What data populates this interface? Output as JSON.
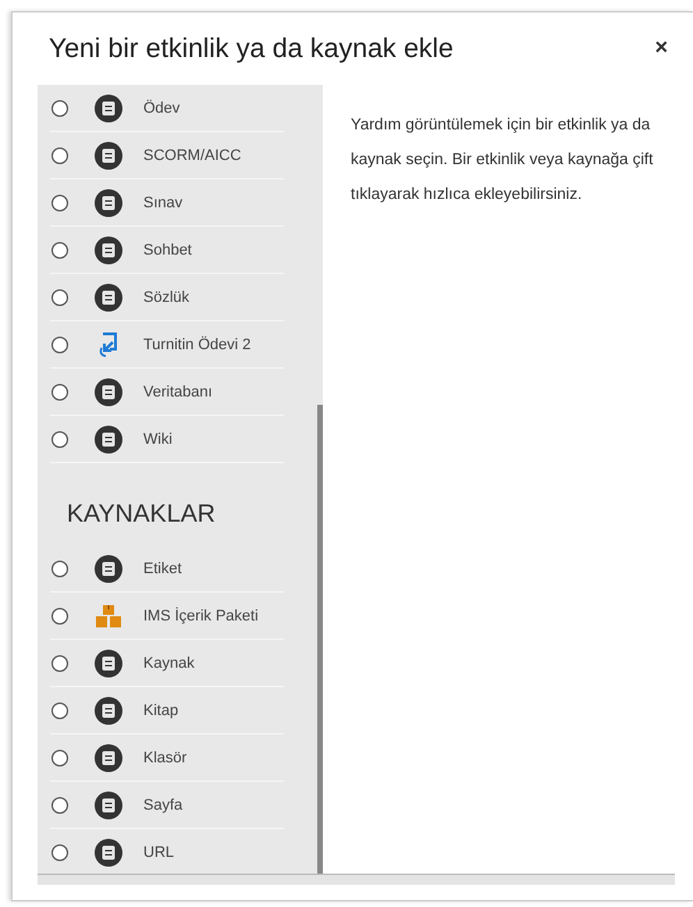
{
  "dialog": {
    "title": "Yeni bir etkinlik ya da kaynak ekle",
    "close": "×"
  },
  "sections": [
    {
      "items": [
        {
          "label": "Ödev",
          "kind": "module",
          "selected": false
        },
        {
          "label": "SCORM/AICC",
          "kind": "module",
          "selected": false
        },
        {
          "label": "Sınav",
          "kind": "module",
          "selected": false
        },
        {
          "label": "Sohbet",
          "kind": "module",
          "selected": false
        },
        {
          "label": "Sözlük",
          "kind": "module",
          "selected": false
        },
        {
          "label": "Turnitin Ödevi 2",
          "kind": "plugin",
          "selected": false
        },
        {
          "label": "Veritabanı",
          "kind": "module",
          "selected": false
        },
        {
          "label": "Wiki",
          "kind": "module",
          "selected": false
        }
      ]
    },
    {
      "heading": "KAYNAKLAR",
      "items": [
        {
          "label": "Etiket",
          "kind": "module",
          "selected": false
        },
        {
          "label": "IMS İçerik Paketi",
          "kind": "package",
          "selected": false
        },
        {
          "label": "Kaynak",
          "kind": "module",
          "selected": false
        },
        {
          "label": "Kitap",
          "kind": "module",
          "selected": false
        },
        {
          "label": "Klasör",
          "kind": "module",
          "selected": false
        },
        {
          "label": "Sayfa",
          "kind": "module",
          "selected": false
        },
        {
          "label": "URL",
          "kind": "module",
          "selected": false
        }
      ]
    }
  ],
  "help_text": "Yardım görüntülemek için bir etkinlik ya da kaynak seçin. Bir etkinlik veya kaynağa çift tıklayarak hızlıca ekleyebilirsiniz."
}
